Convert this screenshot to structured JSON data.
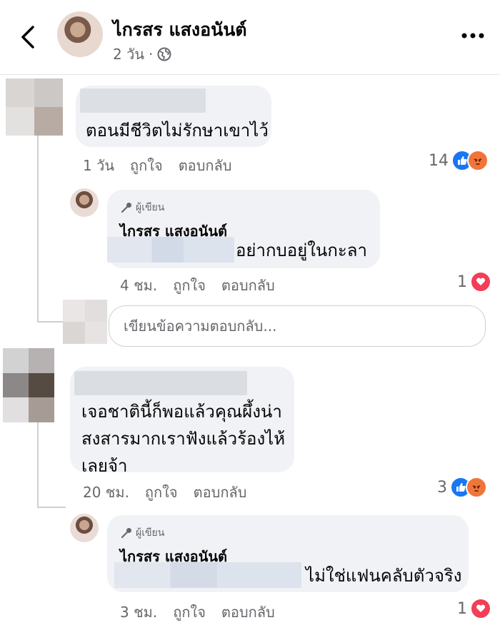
{
  "header": {
    "name": "ไกรสร แสงอนันต์",
    "time": "2 วัน",
    "separator": "·",
    "icons": {
      "back": "chevron-left-icon",
      "privacy": "globe-icon",
      "more": "more-horizontal-icon"
    }
  },
  "comments": [
    {
      "text": "ตอนมีชีวิตไม่รักษาเขาไว้",
      "time": "1 วัน",
      "like_label": "ถูกใจ",
      "reply_label": "ตอบกลับ",
      "reaction_count": "14",
      "reactions": [
        "like",
        "angry"
      ]
    },
    {
      "text": "เจอชาตินี้ก็พอแล้วคุณผึ้งน่า\nสงสารมากเราฟังแล้วร้องไห้\nเลยจ้า",
      "time": "20 ชม.",
      "like_label": "ถูกใจ",
      "reply_label": "ตอบกลับ",
      "reaction_count": "3",
      "reactions": [
        "like",
        "angry"
      ]
    }
  ],
  "replies": [
    {
      "badge": "ผู้เขียน",
      "author": "ไกรสร แสงอนันต์",
      "text": "อย่ากบอยู่ในกะลา",
      "time": "4 ชม.",
      "like_label": "ถูกใจ",
      "reply_label": "ตอบกลับ",
      "reaction_count": "1",
      "reactions": [
        "love"
      ]
    },
    {
      "badge": "ผู้เขียน",
      "author": "ไกรสร แสงอนันต์",
      "text": "ไม่ใช่แฟนคลับตัวจริง",
      "time": "3 ชม.",
      "like_label": "ถูกใจ",
      "reply_label": "ตอบกลับ",
      "reaction_count": "1",
      "reactions": [
        "love"
      ]
    }
  ],
  "reply_input": {
    "placeholder": "เขียนข้อความตอบกลับ..."
  },
  "colors": {
    "like": "#1877f2",
    "angry": "#f0753a",
    "love": "#f33e58",
    "meta": "#65676b",
    "bubble": "#f0f2f5"
  }
}
